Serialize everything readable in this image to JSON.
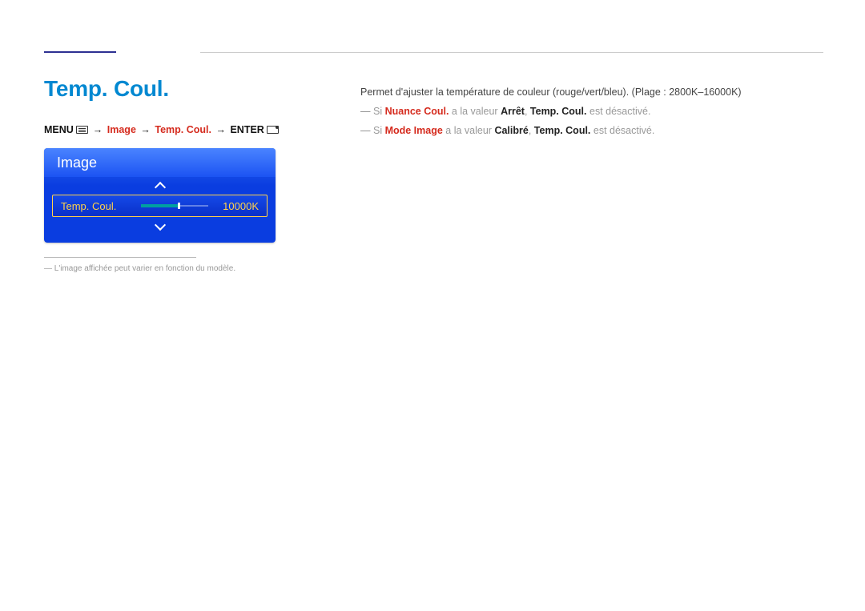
{
  "heading": "Temp. Coul.",
  "path": {
    "menu": "MENU",
    "seg1": "Image",
    "seg2": "Temp. Coul.",
    "enter": "ENTER"
  },
  "osd": {
    "title": "Image",
    "row_label": "Temp. Coul.",
    "row_value": "10000K"
  },
  "footnote": "L'image affichée peut varier en fonction du modèle.",
  "desc": {
    "line1": "Permet d'ajuster la température de couleur (rouge/vert/bleu). (Plage : 2800K–16000K)",
    "note1_pre": "Si ",
    "note1_red": "Nuance Coul.",
    "note1_mid": " a la valeur ",
    "note1_b1": "Arrêt",
    "note1_sep": ", ",
    "note1_b2": "Temp. Coul.",
    "note1_post": " est désactivé.",
    "note2_pre": "Si ",
    "note2_red": "Mode Image",
    "note2_mid": " a la valeur ",
    "note2_b1": "Calibré",
    "note2_sep": ", ",
    "note2_b2": "Temp. Coul.",
    "note2_post": " est désactivé."
  }
}
